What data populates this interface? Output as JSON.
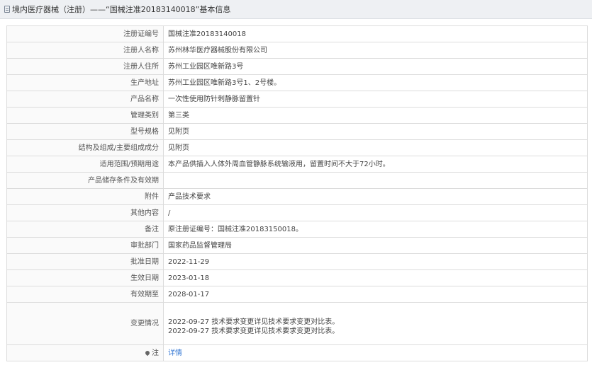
{
  "header": {
    "title": "境内医疗器械（注册）——“国械注准20183140018”基本信息",
    "icon": "document-icon"
  },
  "rows": [
    {
      "label": "注册证编号",
      "value": "国械注准20183140018"
    },
    {
      "label": "注册人名称",
      "value": "苏州林华医疗器械股份有限公司"
    },
    {
      "label": "注册人住所",
      "value": "苏州工业园区唯新路3号"
    },
    {
      "label": "生产地址",
      "value": "苏州工业园区唯新路3号1、2号楼。"
    },
    {
      "label": "产品名称",
      "value": "一次性使用防针刺静脉留置针"
    },
    {
      "label": "管理类别",
      "value": "第三类"
    },
    {
      "label": "型号规格",
      "value": "见附页"
    },
    {
      "label": "结构及组成/主要组成成分",
      "value": "见附页"
    },
    {
      "label": "适用范围/预期用途",
      "value": "本产品供插入人体外周血管静脉系统输液用，留置时间不大于72小时。"
    },
    {
      "label": "产品储存条件及有效期",
      "value": ""
    },
    {
      "label": "附件",
      "value": "产品技术要求"
    },
    {
      "label": "其他内容",
      "value": "/"
    },
    {
      "label": "备注",
      "value": "原注册证编号：国械注准20183150018。"
    },
    {
      "label": "审批部门",
      "value": "国家药品监督管理局"
    },
    {
      "label": "批准日期",
      "value": "2022-11-29"
    },
    {
      "label": "生效日期",
      "value": "2023-01-18"
    },
    {
      "label": "有效期至",
      "value": "2028-01-17"
    }
  ],
  "change": {
    "label": "变更情况",
    "entries": [
      "2022-09-27 技术要求变更详见技术要求变更对比表。",
      "2022-09-27 技术要求变更详见技术要求变更对比表。"
    ]
  },
  "note": {
    "label": "注",
    "icon": "pin-icon",
    "link": "详情",
    "link_color": "#3a7bd5"
  }
}
